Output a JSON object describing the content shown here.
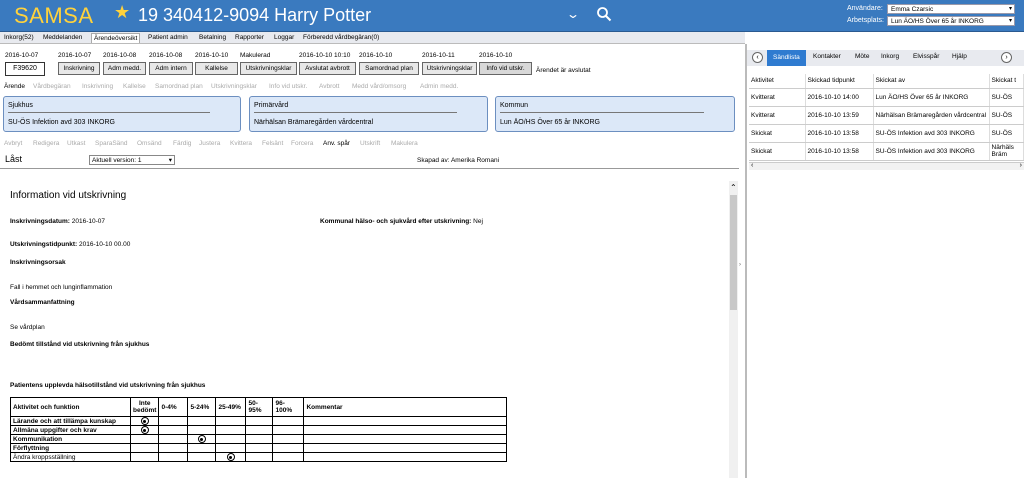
{
  "header": {
    "logo": "SAMSA",
    "patient": "19 340412-9094 Harry Potter",
    "user_label": "Användare:",
    "user_value": "Emma Czarsic",
    "workplace_label": "Arbetsplats:",
    "workplace_value": "Lun ÄO/HS Över 65 år INKORG",
    "brand_color": "#ffd23c",
    "header_color": "#3a7abf"
  },
  "menu": [
    "Inkorg(52)",
    "Meddelanden",
    "Ärendeöversikt",
    "Patient admin",
    "Betalning",
    "Rapporter",
    "Loggar",
    "Förberedd vårdbegäran(0)"
  ],
  "workflow": {
    "case_id": "F39620",
    "dates": [
      "2016-10-07",
      "2016-10-07",
      "2016-10-08",
      "2016-10-08",
      "2016-10-10",
      "Makulerad",
      "2016-10-10 10:10",
      "2016-10-10",
      "2016-10-11",
      "2016-10-10"
    ],
    "steps": [
      "Inskrivning",
      "Adm medd.",
      "Adm intern",
      "Kallelse",
      "Utskrivningsklar",
      "Avslutat avbrott",
      "Samordnad plan",
      "Utskrivningsklar",
      "Info vid utskr."
    ],
    "status": "Ärendet är avslutat"
  },
  "toolbar1": {
    "label": "Ärende",
    "items": [
      "Vårdbegäran",
      "Inskrivning",
      "Kallelse",
      "Samordnad plan",
      "Utskrivningsklar",
      "Info vid utskr.",
      "Avbrott",
      "Medd vård/omsorg",
      "Admin medd."
    ]
  },
  "actors": [
    {
      "title": "Sjukhus",
      "value": "SU-ÖS Infektion avd 303 INKORG"
    },
    {
      "title": "Primärvård",
      "value": "Närhälsan Brämaregården vårdcentral"
    },
    {
      "title": "Kommun",
      "value": "Lun ÄO/HS Över 65 år INKORG"
    }
  ],
  "toolbar2": {
    "items": [
      "Avbryt",
      "Redigera",
      "Utkast",
      "SparaSänd",
      "Omsänd",
      "Färdig",
      "Justera",
      "Kvittera",
      "Felsänt",
      "Forcera",
      "Anv. spår",
      "Utskrift",
      "Makulera"
    ],
    "enabled": "Anv. spår"
  },
  "doc_state": {
    "locked": "Låst",
    "version": "Aktuell version: 1",
    "created_by": "Skapad av: Amerika Romani"
  },
  "document": {
    "title": "Information vid utskrivning",
    "admission_label": "Inskrivningsdatum:",
    "admission_value": "2016-10-07",
    "municipal_label": "Kommunal hälso- och sjukvård efter utskrivning:",
    "municipal_value": "Nej",
    "discharge_label": "Utskrivningstidpunkt:",
    "discharge_value": "2016-10-10 00.00",
    "cause_label": "Inskrivningsorsak",
    "cause_value": "Fall i hemmet och lunginflammation",
    "summary_label": "Vårdsammanfattning",
    "summary_value": "Se vårdplan",
    "assessed_label": "Bedömt tillstånd vid utskrivning från sjukhus",
    "perceived_label": "Patientens upplevda hälsotillstånd vid utskrivning från sjukhus"
  },
  "grid": {
    "headers": [
      "Aktivitet och funktion",
      "Inte bedömt",
      "0-4%",
      "5-24%",
      "25-49%",
      "50-95%",
      "96-100%",
      "Kommentar"
    ],
    "rows": [
      {
        "label": "Lärande och att tillämpa kunskap",
        "sel": 1
      },
      {
        "label": "Allmäna uppgifter och krav",
        "sel": 1
      },
      {
        "label": "Kommunikation",
        "sel": 3
      },
      {
        "label": "Förflyttning",
        "sel": 0
      },
      {
        "label": "Ändra kroppsställning",
        "sel": 4
      }
    ]
  },
  "right_panel": {
    "tabs": [
      "Sändlista",
      "Kontakter",
      "Möte",
      "Inkorg",
      "Elvisspår",
      "Hjälp"
    ],
    "columns": [
      "Aktivitet",
      "Skickad tidpunkt",
      "Skickat av",
      "Skickat t"
    ],
    "rows": [
      [
        "Kvitterat",
        "2016-10-10 14:00",
        "Lun ÄO/HS Över 65 år INKORG",
        "SU-ÖS"
      ],
      [
        "Kvitterat",
        "2016-10-10 13:59",
        "Närhälsan Brämaregården vårdcentral",
        "SU-ÖS"
      ],
      [
        "Skickat",
        "2016-10-10 13:58",
        "SU-ÖS Infektion avd 303 INKORG",
        "SU-ÖS"
      ],
      [
        "Skickat",
        "2016-10-10 13:58",
        "SU-ÖS Infektion avd 303 INKORG",
        "Närhäls Bräm"
      ]
    ]
  }
}
